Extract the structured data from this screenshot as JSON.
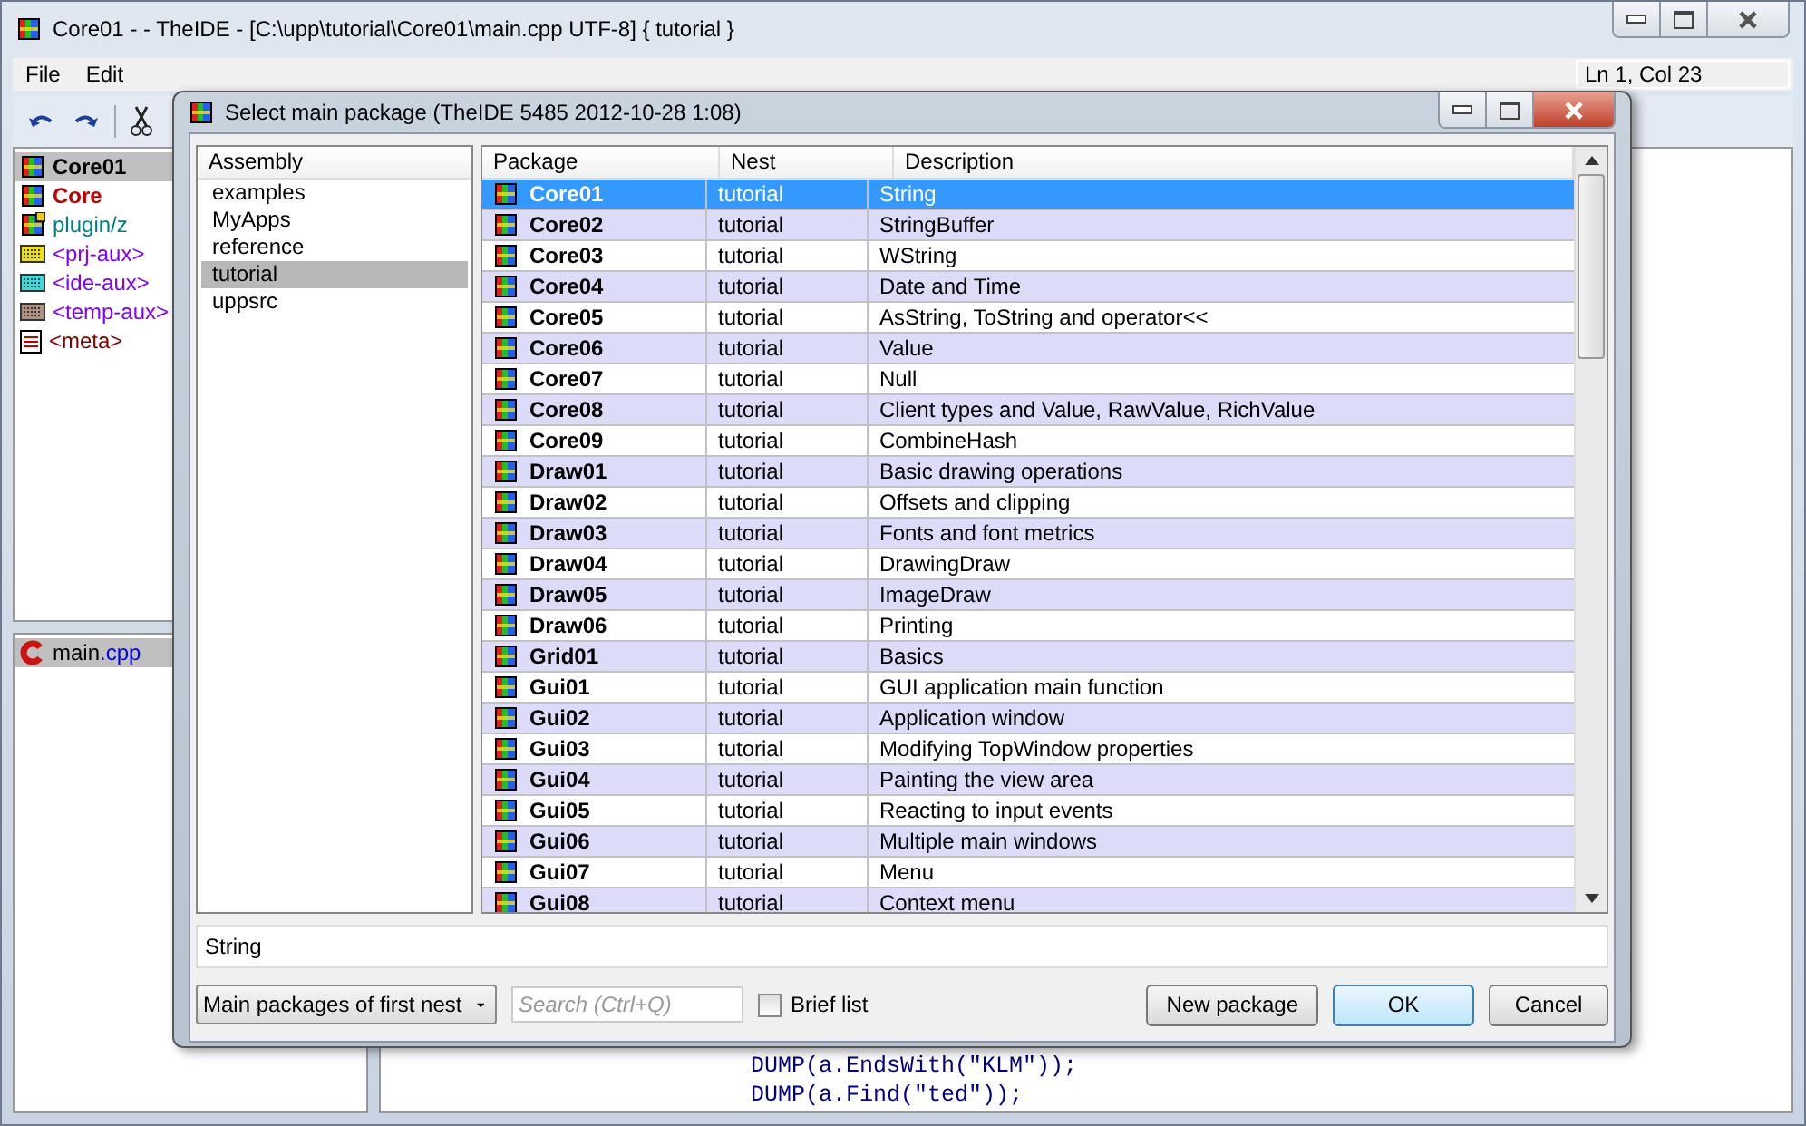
{
  "window": {
    "title": "Core01 -  - TheIDE - [C:\\upp\\tutorial\\Core01\\main.cpp UTF-8] { tutorial }"
  },
  "menu": [
    "File",
    "Edit"
  ],
  "status": "Ln 1, Col 23",
  "packages": [
    {
      "name": "Core01",
      "kind": "package",
      "color": "#000000",
      "selected": true
    },
    {
      "name": "Core",
      "kind": "package",
      "color": "#c00000",
      "selected": false
    },
    {
      "name": "plugin/z",
      "kind": "package-flag",
      "color": "#008080",
      "selected": false
    },
    {
      "name": "<prj-aux>",
      "kind": "aux",
      "color": "#8000ff",
      "selected": false
    },
    {
      "name": "<ide-aux>",
      "kind": "aux-cyan",
      "color": "#8000ff",
      "selected": false
    },
    {
      "name": "<temp-aux>",
      "kind": "aux-brown",
      "color": "#8000ff",
      "selected": false
    },
    {
      "name": "<meta>",
      "kind": "meta",
      "color": "#800000",
      "selected": false
    }
  ],
  "files": [
    {
      "name": "main",
      "ext": ".cpp",
      "selected": true
    }
  ],
  "code": [
    "DUMP(a.EndsWith(\"KLM\"));",
    "DUMP(a.Find(\"ted\"));"
  ],
  "dialog": {
    "title": "Select main package (TheIDE 5485 2012-10-28 1:08)",
    "assembly_header": "Assembly",
    "assemblies": [
      {
        "name": "examples",
        "selected": false
      },
      {
        "name": "MyApps",
        "selected": false
      },
      {
        "name": "reference",
        "selected": false
      },
      {
        "name": "tutorial",
        "selected": true
      },
      {
        "name": "uppsrc",
        "selected": false
      }
    ],
    "columns": [
      "Package",
      "Nest",
      "Description"
    ],
    "rows": [
      {
        "package": "Core01",
        "nest": "tutorial",
        "description": "String",
        "selected": true
      },
      {
        "package": "Core02",
        "nest": "tutorial",
        "description": "StringBuffer",
        "selected": false
      },
      {
        "package": "Core03",
        "nest": "tutorial",
        "description": "WString",
        "selected": false
      },
      {
        "package": "Core04",
        "nest": "tutorial",
        "description": "Date and Time",
        "selected": false
      },
      {
        "package": "Core05",
        "nest": "tutorial",
        "description": "AsString, ToString and operator<<",
        "selected": false
      },
      {
        "package": "Core06",
        "nest": "tutorial",
        "description": "Value",
        "selected": false
      },
      {
        "package": "Core07",
        "nest": "tutorial",
        "description": "Null",
        "selected": false
      },
      {
        "package": "Core08",
        "nest": "tutorial",
        "description": "Client types and Value, RawValue, RichValue",
        "selected": false
      },
      {
        "package": "Core09",
        "nest": "tutorial",
        "description": "CombineHash",
        "selected": false
      },
      {
        "package": "Draw01",
        "nest": "tutorial",
        "description": "Basic drawing operations",
        "selected": false
      },
      {
        "package": "Draw02",
        "nest": "tutorial",
        "description": "Offsets and clipping",
        "selected": false
      },
      {
        "package": "Draw03",
        "nest": "tutorial",
        "description": "Fonts and font metrics",
        "selected": false
      },
      {
        "package": "Draw04",
        "nest": "tutorial",
        "description": "DrawingDraw",
        "selected": false
      },
      {
        "package": "Draw05",
        "nest": "tutorial",
        "description": "ImageDraw",
        "selected": false
      },
      {
        "package": "Draw06",
        "nest": "tutorial",
        "description": "Printing",
        "selected": false
      },
      {
        "package": "Grid01",
        "nest": "tutorial",
        "description": "Basics",
        "selected": false
      },
      {
        "package": "Gui01",
        "nest": "tutorial",
        "description": "GUI application main function",
        "selected": false
      },
      {
        "package": "Gui02",
        "nest": "tutorial",
        "description": " Application window",
        "selected": false
      },
      {
        "package": "Gui03",
        "nest": "tutorial",
        "description": "Modifying TopWindow properties",
        "selected": false
      },
      {
        "package": "Gui04",
        "nest": "tutorial",
        "description": "Painting the view area",
        "selected": false
      },
      {
        "package": "Gui05",
        "nest": "tutorial",
        "description": "Reacting to input events",
        "selected": false
      },
      {
        "package": "Gui06",
        "nest": "tutorial",
        "description": "Multiple main windows",
        "selected": false
      },
      {
        "package": "Gui07",
        "nest": "tutorial",
        "description": "Menu",
        "selected": false
      },
      {
        "package": "Gui08",
        "nest": "tutorial",
        "description": "Context menu",
        "selected": false
      }
    ],
    "description_value": "String",
    "filter": "Main packages of first nest",
    "search": {
      "placeholder": "Search (Ctrl+Q)"
    },
    "brief_list": {
      "label": "Brief list",
      "checked": false
    },
    "buttons": [
      {
        "label": "New package",
        "default": false
      },
      {
        "label": "OK",
        "default": true
      },
      {
        "label": "Cancel",
        "default": false
      }
    ]
  }
}
